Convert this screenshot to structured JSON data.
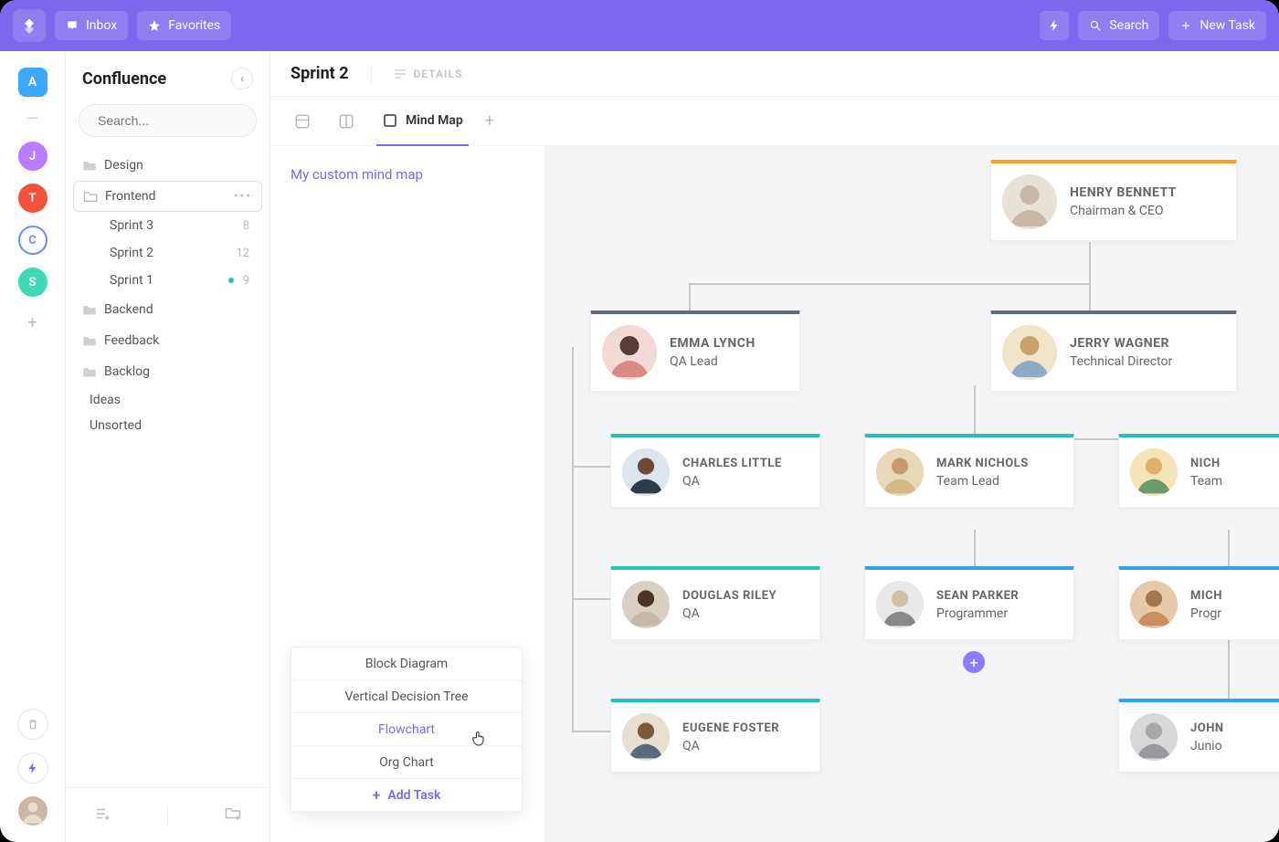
{
  "topbar": {
    "inbox": "Inbox",
    "favorites": "Favorites",
    "search": "Search",
    "newTask": "New Task"
  },
  "rail": {
    "a": "A",
    "j": "J",
    "t": "T",
    "c": "C",
    "s": "S"
  },
  "sidebar": {
    "title": "Confluence",
    "searchPlaceholder": "Search...",
    "items": {
      "design": "Design",
      "frontend": "Frontend",
      "sprint3": "Sprint 3",
      "sprint3_count": "8",
      "sprint2": "Sprint 2",
      "sprint2_count": "12",
      "sprint1": "Sprint 1",
      "sprint1_count": "9",
      "backend": "Backend",
      "feedback": "Feedback",
      "backlog": "Backlog",
      "ideas": "Ideas",
      "unsorted": "Unsorted"
    }
  },
  "main": {
    "title": "Sprint 2",
    "details": "DETAILS",
    "mindmap": "Mind Map",
    "crumb": "My custom mind map"
  },
  "popup": {
    "i0": "Block Diagram",
    "i1": "Vertical Decision Tree",
    "i2": "Flowchart",
    "i3": "Org Chart",
    "add": "Add Task"
  },
  "org": {
    "ceo_name": "HENRY BENNETT",
    "ceo_role": "Chairman & CEO",
    "qa_lead_name": "EMMA LYNCH",
    "qa_lead_role": "QA Lead",
    "tech_dir_name": "JERRY WAGNER",
    "tech_dir_role": "Technical Director",
    "qa1_name": "CHARLES LITTLE",
    "qa1_role": "QA",
    "tl_name": "MARK NICHOLS",
    "tl_role": "Team Lead",
    "cut1_name": "NICH",
    "cut1_role": "Team",
    "qa2_name": "DOUGLAS RILEY",
    "qa2_role": "QA",
    "prog_name": "SEAN PARKER",
    "prog_role": "Programmer",
    "cut2_name": "MICH",
    "cut2_role": "Progr",
    "qa3_name": "EUGENE FOSTER",
    "qa3_role": "QA",
    "cut3_name": "JOHN",
    "cut3_role": "Junio"
  },
  "colors": {
    "brand": "#7B68EE",
    "orange": "#FF9F1A",
    "slate": "#5F6C7B",
    "teal": "#1EC6B6",
    "blue": "#2EA3F2"
  }
}
